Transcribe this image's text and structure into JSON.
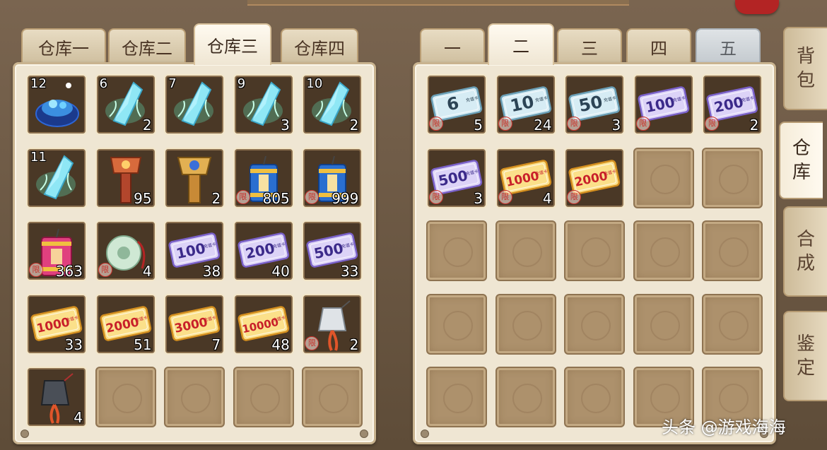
{
  "left_panel": {
    "tabs": [
      {
        "label": "仓库一",
        "active": false
      },
      {
        "label": "仓库二",
        "active": false
      },
      {
        "label": "仓库三",
        "active": true
      },
      {
        "label": "仓库四",
        "active": false
      }
    ],
    "slots": [
      {
        "icon": "crystal-cluster-icon",
        "level": "12",
        "qty": ""
      },
      {
        "icon": "blue-crystal-icon",
        "level": "6",
        "qty": "2"
      },
      {
        "icon": "blue-crystal-icon",
        "level": "7",
        "qty": ""
      },
      {
        "icon": "blue-crystal-icon",
        "level": "9",
        "qty": "3"
      },
      {
        "icon": "blue-crystal-icon",
        "level": "10",
        "qty": "2"
      },
      {
        "icon": "blue-crystal-icon",
        "level": "11",
        "qty": ""
      },
      {
        "icon": "red-banner-icon",
        "level": "",
        "qty": "95"
      },
      {
        "icon": "blue-banner-icon",
        "level": "",
        "qty": "2"
      },
      {
        "icon": "blue-firecracker-icon",
        "level": "",
        "qty": "805",
        "bound": true
      },
      {
        "icon": "blue-firecracker-icon",
        "level": "",
        "qty": "999",
        "bound": true
      },
      {
        "icon": "pink-firecracker-icon",
        "level": "",
        "qty": "363",
        "bound": true
      },
      {
        "icon": "jade-pendant-icon",
        "level": "",
        "qty": "4",
        "bound": true
      },
      {
        "icon": "purple-card-icon",
        "card": "100",
        "level": "",
        "qty": "38"
      },
      {
        "icon": "purple-card-icon",
        "card": "200",
        "level": "",
        "qty": "40"
      },
      {
        "icon": "purple-card-icon",
        "card": "500",
        "level": "",
        "qty": "33"
      },
      {
        "icon": "gold-card-icon",
        "card": "1000",
        "level": "",
        "qty": "33"
      },
      {
        "icon": "gold-card-icon",
        "card": "2000",
        "level": "",
        "qty": "51"
      },
      {
        "icon": "gold-card-icon",
        "card": "3000",
        "level": "",
        "qty": "7"
      },
      {
        "icon": "gold-card-icon",
        "card": "10000",
        "level": "",
        "qty": "48"
      },
      {
        "icon": "silver-amulet-icon",
        "level": "",
        "qty": "2",
        "bound": true
      },
      {
        "icon": "dark-amulet-icon",
        "level": "",
        "qty": "4"
      },
      {
        "icon": "",
        "level": "",
        "qty": ""
      },
      {
        "icon": "",
        "level": "",
        "qty": ""
      },
      {
        "icon": "",
        "level": "",
        "qty": ""
      },
      {
        "icon": "",
        "level": "",
        "qty": ""
      }
    ]
  },
  "right_panel": {
    "tabs": [
      {
        "label": "一",
        "active": false
      },
      {
        "label": "二",
        "active": true
      },
      {
        "label": "三",
        "active": false
      },
      {
        "label": "四",
        "active": false
      },
      {
        "label": "五",
        "active": false,
        "disabled": true
      }
    ],
    "slots": [
      {
        "icon": "blue-card-icon",
        "card": "6",
        "qty": "5",
        "bound": true
      },
      {
        "icon": "blue-card-icon",
        "card": "10",
        "qty": "24",
        "bound": true
      },
      {
        "icon": "blue-card-icon",
        "card": "50",
        "qty": "3",
        "bound": true
      },
      {
        "icon": "purple-card-icon",
        "card": "100",
        "qty": "",
        "bound": true
      },
      {
        "icon": "purple-card-icon",
        "card": "200",
        "qty": "2",
        "bound": true
      },
      {
        "icon": "purple-card-icon",
        "card": "500",
        "qty": "3",
        "bound": true
      },
      {
        "icon": "gold-card-icon",
        "card": "1000",
        "qty": "4",
        "bound": true
      },
      {
        "icon": "gold-card-icon",
        "card": "2000",
        "qty": "",
        "bound": true
      },
      {
        "icon": "",
        "qty": ""
      },
      {
        "icon": "",
        "qty": ""
      },
      {
        "icon": "",
        "qty": ""
      },
      {
        "icon": "",
        "qty": ""
      },
      {
        "icon": "",
        "qty": ""
      },
      {
        "icon": "",
        "qty": ""
      },
      {
        "icon": "",
        "qty": ""
      },
      {
        "icon": "",
        "qty": ""
      },
      {
        "icon": "",
        "qty": ""
      },
      {
        "icon": "",
        "qty": ""
      },
      {
        "icon": "",
        "qty": ""
      },
      {
        "icon": "",
        "qty": ""
      },
      {
        "icon": "",
        "qty": ""
      },
      {
        "icon": "",
        "qty": ""
      },
      {
        "icon": "",
        "qty": ""
      },
      {
        "icon": "",
        "qty": ""
      },
      {
        "icon": "",
        "qty": ""
      }
    ]
  },
  "side_tabs": [
    {
      "label": "背包",
      "chars": [
        "背",
        "包"
      ],
      "active": false
    },
    {
      "label": "仓库",
      "chars": [
        "仓",
        "库"
      ],
      "active": true
    },
    {
      "label": "合成",
      "chars": [
        "合",
        "成"
      ],
      "active": false
    },
    {
      "label": "鉴定",
      "chars": [
        "鉴",
        "定"
      ],
      "active": false
    }
  ],
  "card_text": "充值卡",
  "bound_mark": "限",
  "watermark": "头条 @游戏海海"
}
